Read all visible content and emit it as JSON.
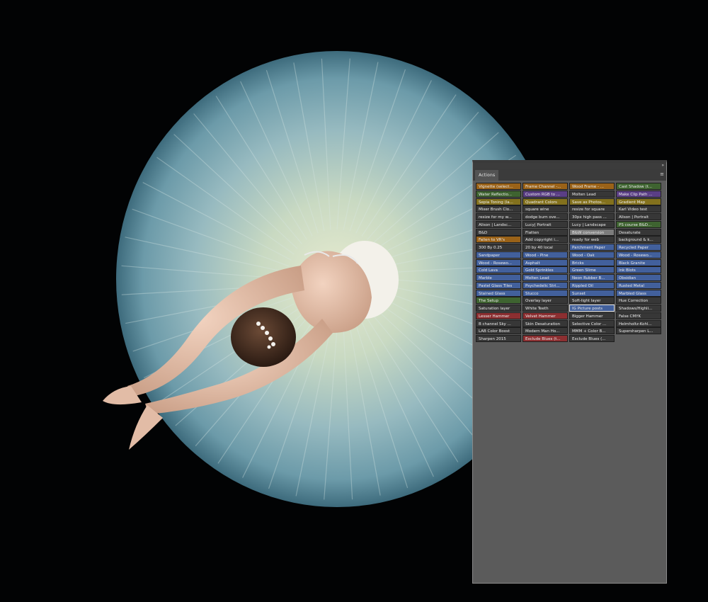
{
  "panel": {
    "tab_label": "Actions",
    "menu_icon": "panel-menu-icon",
    "collapse_icon": "collapse-icon"
  },
  "colors": {
    "none": "#373737",
    "orange": "#9a6218",
    "green": "#3e6330",
    "violet": "#5a3e85",
    "blue": "#42609c",
    "red": "#8c2f31",
    "gray": "#7c7c7c",
    "yellow": "#83711d"
  },
  "actions": [
    {
      "label": "Vignette (select...",
      "color": "orange"
    },
    {
      "label": "Frame Channel -...",
      "color": "orange"
    },
    {
      "label": "Wood Frame - ...",
      "color": "orange"
    },
    {
      "label": "Cast Shadow (t...",
      "color": "green"
    },
    {
      "label": "Water Reflectio...",
      "color": "green"
    },
    {
      "label": "Custom RGB to ...",
      "color": "violet"
    },
    {
      "label": "Molten Lead",
      "color": "none"
    },
    {
      "label": "Make Clip Path ...",
      "color": "violet"
    },
    {
      "label": "Sepia Toning (la...",
      "color": "yellow"
    },
    {
      "label": "Quadrant Colors",
      "color": "yellow"
    },
    {
      "label": "Save as Photos...",
      "color": "yellow"
    },
    {
      "label": "Gradient Map",
      "color": "yellow"
    },
    {
      "label": "Mixer Brush Clo...",
      "color": "none"
    },
    {
      "label": "square wine",
      "color": "none"
    },
    {
      "label": "resize for square",
      "color": "none"
    },
    {
      "label": "Karl Video test",
      "color": "none"
    },
    {
      "label": "resize for my w...",
      "color": "none"
    },
    {
      "label": "dodge burn ove...",
      "color": "none"
    },
    {
      "label": "30px high pass ...",
      "color": "none"
    },
    {
      "label": "Alison | Portrait",
      "color": "none"
    },
    {
      "label": "Alison | Landsc...",
      "color": "none"
    },
    {
      "label": "Lucy| Portrait",
      "color": "none"
    },
    {
      "label": "Lucy | Landscape",
      "color": "none"
    },
    {
      "label": "PS course B&D...",
      "color": "green"
    },
    {
      "label": "B&D",
      "color": "none"
    },
    {
      "label": "Flatten",
      "color": "none"
    },
    {
      "label": "B&W conversion",
      "color": "gray"
    },
    {
      "label": "Desaturate",
      "color": "none"
    },
    {
      "label": "Fallen to VR's",
      "color": "orange"
    },
    {
      "label": "Add copyright i...",
      "color": "none"
    },
    {
      "label": "ready for web",
      "color": "none"
    },
    {
      "label": "background & k...",
      "color": "none"
    },
    {
      "label": "300 By 0.25",
      "color": "none"
    },
    {
      "label": "20 by 40 local",
      "color": "none"
    },
    {
      "label": "Parchment Paper",
      "color": "blue"
    },
    {
      "label": "Recycled Paper",
      "color": "blue"
    },
    {
      "label": "Sandpaper",
      "color": "blue"
    },
    {
      "label": "Wood - Pine",
      "color": "blue"
    },
    {
      "label": "Wood - Oak",
      "color": "blue"
    },
    {
      "label": "Wood - Rosewo...",
      "color": "blue"
    },
    {
      "label": "Wood - Rosewo...",
      "color": "blue"
    },
    {
      "label": "Asphalt",
      "color": "blue"
    },
    {
      "label": "Bricks",
      "color": "blue"
    },
    {
      "label": "Black Granite",
      "color": "blue"
    },
    {
      "label": "Cold Lava",
      "color": "blue"
    },
    {
      "label": "Gold Sprinkles",
      "color": "blue"
    },
    {
      "label": "Green Slime",
      "color": "blue"
    },
    {
      "label": "Ink Blots",
      "color": "blue"
    },
    {
      "label": "Marble",
      "color": "blue"
    },
    {
      "label": "Molten Lead",
      "color": "blue"
    },
    {
      "label": "Neon Rubber B...",
      "color": "blue"
    },
    {
      "label": "Obsidian",
      "color": "blue"
    },
    {
      "label": "Pastel Glass Tiles",
      "color": "blue"
    },
    {
      "label": "Psychedelic Stri...",
      "color": "blue"
    },
    {
      "label": "Rippled Oil",
      "color": "blue"
    },
    {
      "label": "Rusted Metal",
      "color": "blue"
    },
    {
      "label": "Stained Glass",
      "color": "blue"
    },
    {
      "label": "Stucco",
      "color": "blue"
    },
    {
      "label": "Sunset",
      "color": "blue"
    },
    {
      "label": "Marbled Glass",
      "color": "blue"
    },
    {
      "label": "The Setup",
      "color": "green"
    },
    {
      "label": "Overlay layer",
      "color": "none"
    },
    {
      "label": "Soft-light layer",
      "color": "none"
    },
    {
      "label": "Hue Correction",
      "color": "none"
    },
    {
      "label": "Saturation layer",
      "color": "none"
    },
    {
      "label": "White Teeth",
      "color": "none"
    },
    {
      "label": "IG Picture posts",
      "color": "blue",
      "selected": true
    },
    {
      "label": "Shadows/Highli...",
      "color": "none"
    },
    {
      "label": "Lesser Hammer",
      "color": "red"
    },
    {
      "label": "Velvet Hammer",
      "color": "red"
    },
    {
      "label": "Bigger Hammer",
      "color": "none"
    },
    {
      "label": "False CMYK",
      "color": "none"
    },
    {
      "label": "B channel Sky ...",
      "color": "none"
    },
    {
      "label": "Skin Desaturation",
      "color": "none"
    },
    {
      "label": "Selective Color ...",
      "color": "none"
    },
    {
      "label": "Helmholtz-Kohl...",
      "color": "none"
    },
    {
      "label": "LAB Color Boost",
      "color": "none"
    },
    {
      "label": "Modern Man Ho...",
      "color": "none"
    },
    {
      "label": "MMM + Color B...",
      "color": "none"
    },
    {
      "label": "Supersharpen L...",
      "color": "none"
    },
    {
      "label": "Sharpen 2015",
      "color": "none"
    },
    {
      "label": "Exclude Blues (t...",
      "color": "red"
    },
    {
      "label": "Exclude Blues (...",
      "color": "none"
    }
  ]
}
